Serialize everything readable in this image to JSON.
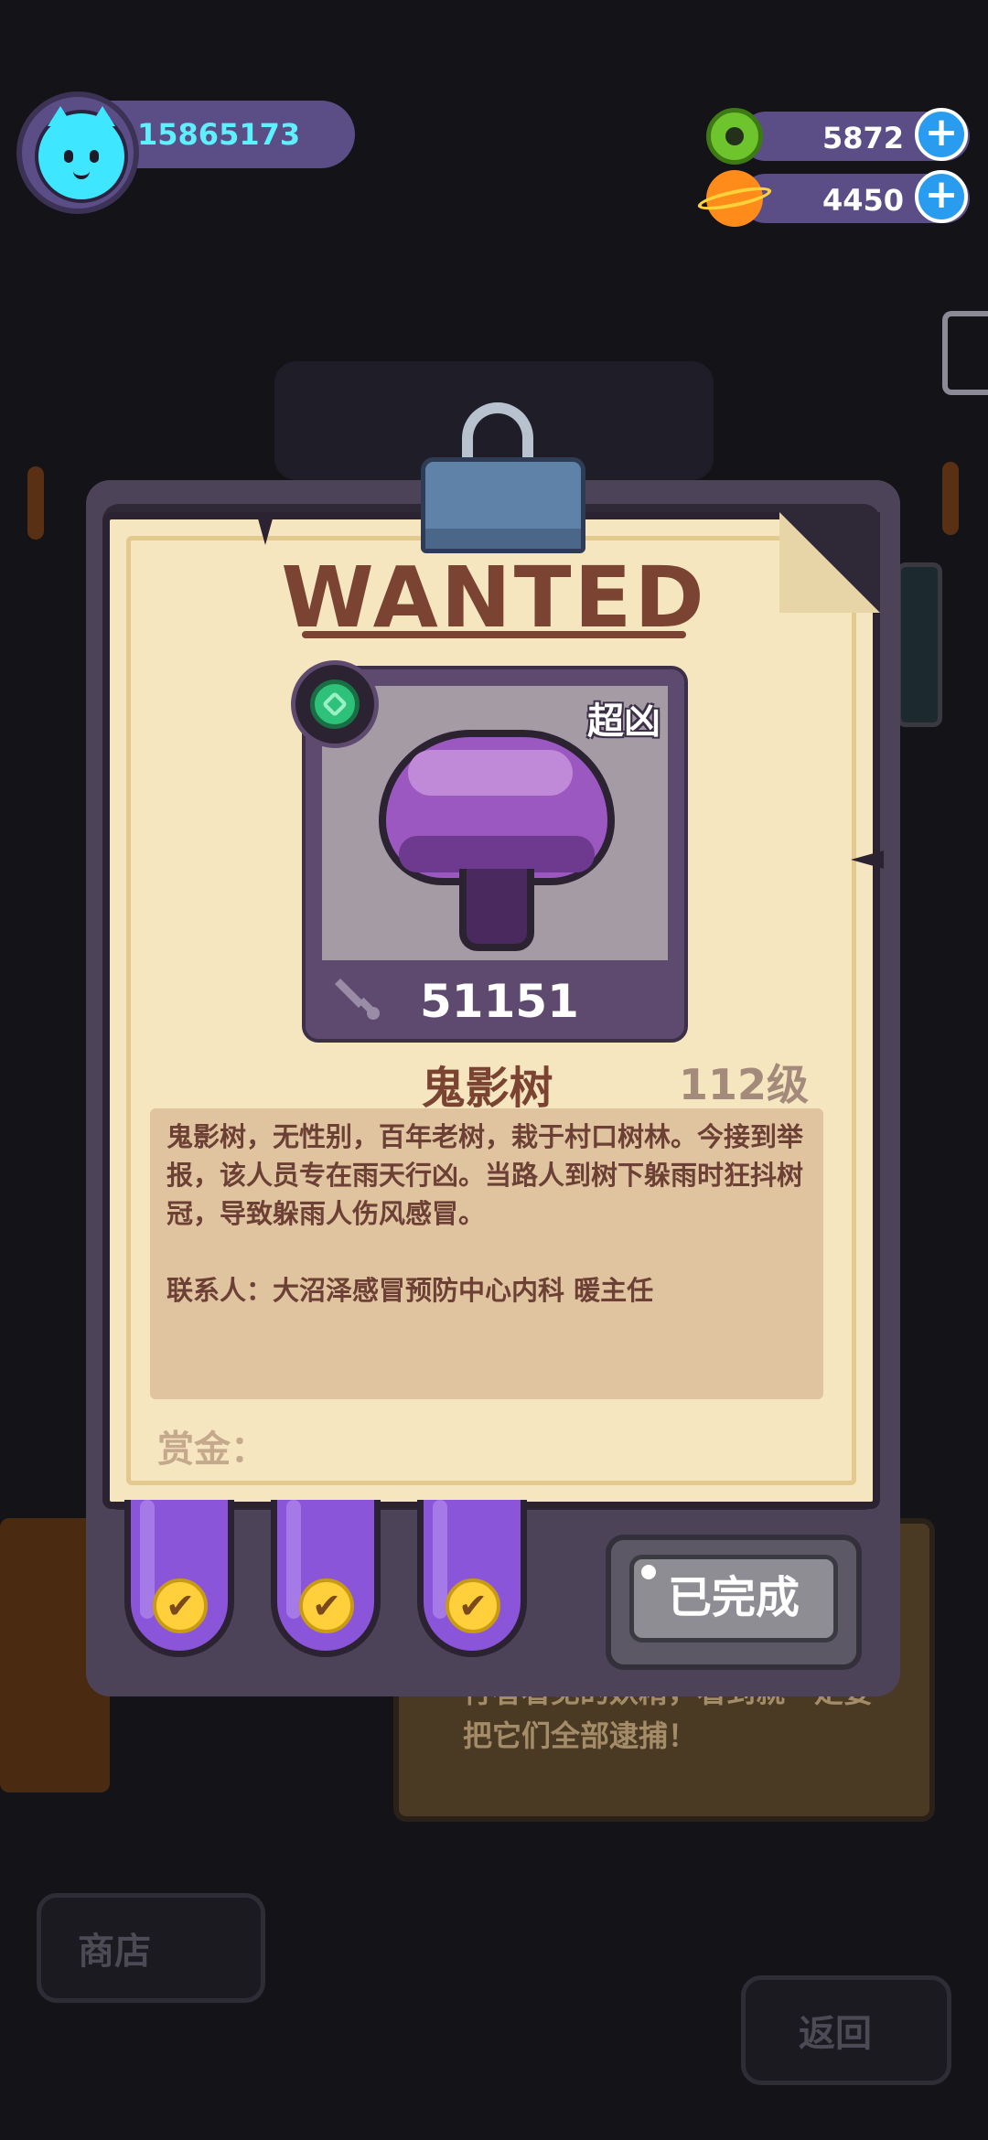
{
  "hud": {
    "player_id": "15865173",
    "avatar_icon": "cat-avatar-icon",
    "currencies": [
      {
        "name": "donut",
        "icon": "green-donut-icon",
        "value": "5872"
      },
      {
        "name": "planet",
        "icon": "orange-planet-icon",
        "value": "4450"
      }
    ],
    "plus_label": "+"
  },
  "wanted": {
    "title": "WANTED",
    "rank_tag": "超凶",
    "power": "51151",
    "monster_name": "鬼影树",
    "level": "112级",
    "description": "鬼影树，无性别，百年老树，栽于村口树林。今接到举报，该人员专在雨天行凶。当路人到树下躲雨时狂抖树冠，导致躲雨人伤风感冒。",
    "contact": "联系人：大沼泽感冒预防中心内科 暖主任",
    "reward_label": "赏金：",
    "checks": [
      "✔",
      "✔",
      "✔"
    ],
    "done_button": "已完成"
  },
  "background": {
    "note_text": "行者看见的妖精，看到就一定要把它们全部逮捕！",
    "left_button": "商店",
    "right_button": "返回"
  },
  "colors": {
    "title_brown": "#7a4332",
    "paper": "#f5e6c0",
    "ribbon_purple": "#8a55d8",
    "hud_purple": "#5b4e86",
    "id_cyan": "#5ff0ff"
  }
}
